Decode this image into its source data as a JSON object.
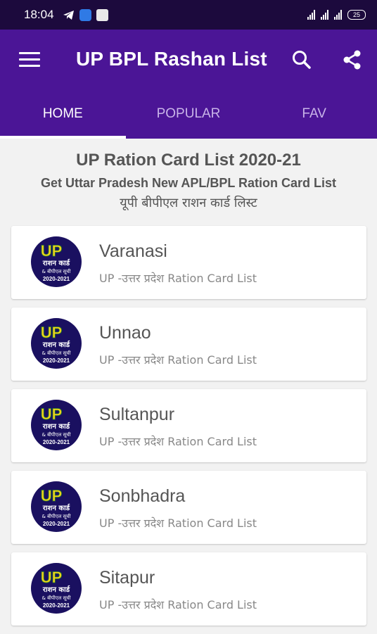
{
  "status_bar": {
    "time": "18:04",
    "battery": "25"
  },
  "app_bar": {
    "title": "UP BPL Rashan List",
    "icons": [
      "menu-icon",
      "search-icon",
      "share-icon"
    ]
  },
  "tabs": [
    {
      "label": "HOME",
      "active": true
    },
    {
      "label": "POPULAR",
      "active": false
    },
    {
      "label": "FAV",
      "active": false
    }
  ],
  "header": {
    "title": "UP Ration Card List 2020-21",
    "subtitle": "Get Uttar Pradesh New APL/BPL Ration Card List",
    "hindi": "यूपी बीपीएल राशन कार्ड लिस्ट"
  },
  "logo": {
    "up": "UP",
    "line1": "राशन कार्ड",
    "line2": "& बीपीएल सूची",
    "year": "2020-2021"
  },
  "districts": [
    {
      "name": "Varanasi",
      "subtitle": "UP -उत्तर प्रदेश Ration Card List"
    },
    {
      "name": "Unnao",
      "subtitle": "UP -उत्तर प्रदेश Ration Card List"
    },
    {
      "name": "Sultanpur",
      "subtitle": "UP -उत्तर प्रदेश Ration Card List"
    },
    {
      "name": "Sonbhadra",
      "subtitle": "UP -उत्तर प्रदेश Ration Card List"
    },
    {
      "name": "Sitapur",
      "subtitle": "UP -उत्तर प्रदेश Ration Card List"
    }
  ],
  "colors": {
    "app_bar": "#4b1596",
    "status_bar": "#1c0a3d",
    "background": "#f2f2f2",
    "logo_circle": "#1a1060",
    "logo_up": "#f7d21a",
    "logo_year": "#ff4d6d"
  }
}
